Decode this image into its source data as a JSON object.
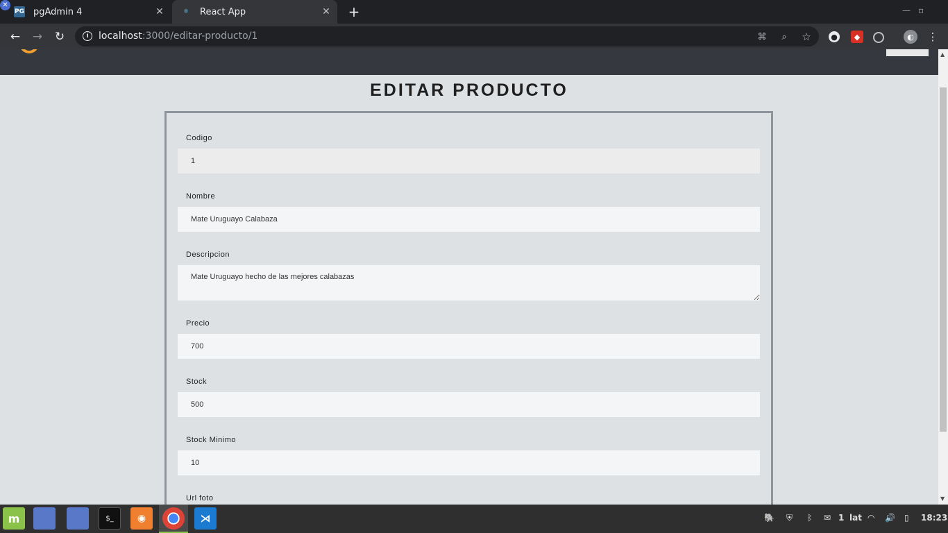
{
  "browser": {
    "tabs": [
      {
        "favicon": "PG",
        "title": "pgAdmin 4"
      },
      {
        "favicon": "⚛",
        "title": "React App"
      }
    ],
    "url_host": "localhost",
    "url_rest": ":3000/editar-producto/1"
  },
  "page": {
    "title": "EDITAR PRODUCTO",
    "fields": {
      "codigo": {
        "label": "Codigo",
        "value": "1"
      },
      "nombre": {
        "label": "Nombre",
        "value": "Mate Uruguayo Calabaza"
      },
      "descripcion": {
        "label": "Descripcion",
        "value": "Mate Uruguayo hecho de las mejores calabazas"
      },
      "precio": {
        "label": "Precio",
        "value": "700"
      },
      "stock": {
        "label": "Stock",
        "value": "500"
      },
      "stock_minimo": {
        "label": "Stock Minimo",
        "value": "10"
      },
      "url_foto": {
        "label": "Url foto"
      }
    }
  },
  "taskbar": {
    "notification_count": "1",
    "keyboard_layout": "lat",
    "clock": "18:23"
  },
  "colors": {
    "header_bg": "#35383f",
    "page_bg": "#dee1e4",
    "input_bg": "#f4f5f6",
    "accent_logo": "#f0a030"
  }
}
